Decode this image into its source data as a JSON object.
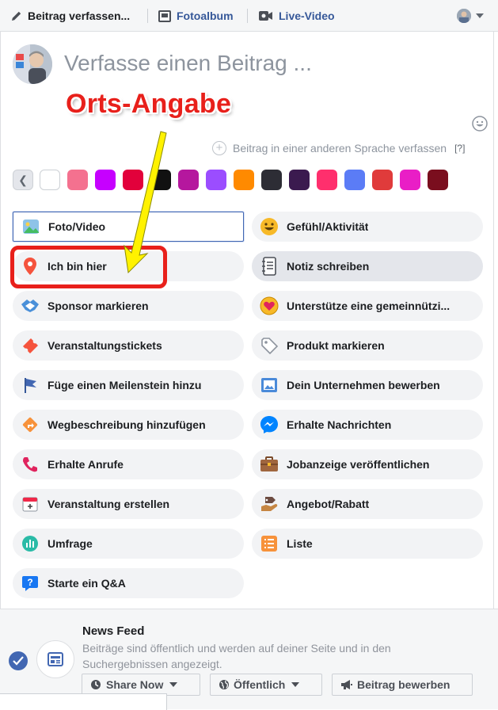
{
  "top_tabs": {
    "compose": "Beitrag verfassen...",
    "photo_album": "Fotoalbum",
    "live_video": "Live-Video"
  },
  "composer": {
    "placeholder": "Verfasse einen Beitrag ...",
    "annotation": "Orts-Angabe",
    "other_language": "Beitrag in einer anderen Sprache verfassen",
    "help": "[?]"
  },
  "background_colors": [
    "#ffffff",
    "#f4718f",
    "#c600ff",
    "#e2013b",
    "#111111",
    "#b5179e",
    "#9b4dff",
    "#ff8a00",
    "#2d2d35",
    "#3b1a4f",
    "#ff2f6d",
    "#5b7cf6",
    "#e03b3b",
    "#e91ec6",
    "#7a0e1e"
  ],
  "options_left": [
    {
      "label": "Foto/Video",
      "icon": "photo-icon"
    },
    {
      "label": "Ich bin hier",
      "icon": "location-pin-icon"
    },
    {
      "label": "Sponsor markieren",
      "icon": "handshake-icon"
    },
    {
      "label": "Veranstaltungstickets",
      "icon": "ticket-icon"
    },
    {
      "label": "Füge einen Meilenstein hinzu",
      "icon": "flag-icon"
    },
    {
      "label": "Wegbeschreibung hinzufügen",
      "icon": "directions-icon"
    },
    {
      "label": "Erhalte Anrufe",
      "icon": "phone-icon"
    },
    {
      "label": "Veranstaltung erstellen",
      "icon": "calendar-icon"
    },
    {
      "label": "Umfrage",
      "icon": "poll-icon"
    },
    {
      "label": "Starte ein Q&A",
      "icon": "question-icon"
    }
  ],
  "options_right": [
    {
      "label": "Gefühl/Aktivität",
      "icon": "smiley-icon"
    },
    {
      "label": "Notiz schreiben",
      "icon": "notebook-icon"
    },
    {
      "label": "Unterstütze eine gemeinnützi...",
      "icon": "heart-coin-icon"
    },
    {
      "label": "Produkt markieren",
      "icon": "tag-icon"
    },
    {
      "label": "Dein Unternehmen bewerben",
      "icon": "image-frame-icon"
    },
    {
      "label": "Erhalte Nachrichten",
      "icon": "messenger-icon"
    },
    {
      "label": "Jobanzeige veröffentlichen",
      "icon": "briefcase-icon"
    },
    {
      "label": "Angebot/Rabatt",
      "icon": "offer-icon"
    },
    {
      "label": "Liste",
      "icon": "list-icon"
    }
  ],
  "footer": {
    "title": "News Feed",
    "description": "Beiträge sind öffentlich und werden auf deiner Seite und in den Suchergebnissen angezeigt.",
    "share_now": "Share Now",
    "audience": "Öffentlich",
    "promote": "Beitrag bewerben"
  }
}
